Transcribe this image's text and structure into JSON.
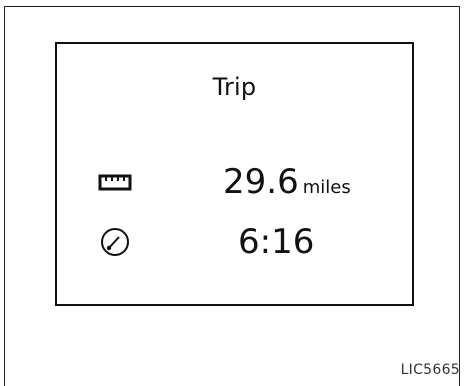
{
  "screen": {
    "title": "Trip",
    "distance": {
      "icon": "ruler-odometer-icon",
      "value": "29.6",
      "unit": "miles"
    },
    "time": {
      "icon": "clock-gauge-icon",
      "value": "6:16"
    }
  },
  "figure_code": "LIC5665"
}
